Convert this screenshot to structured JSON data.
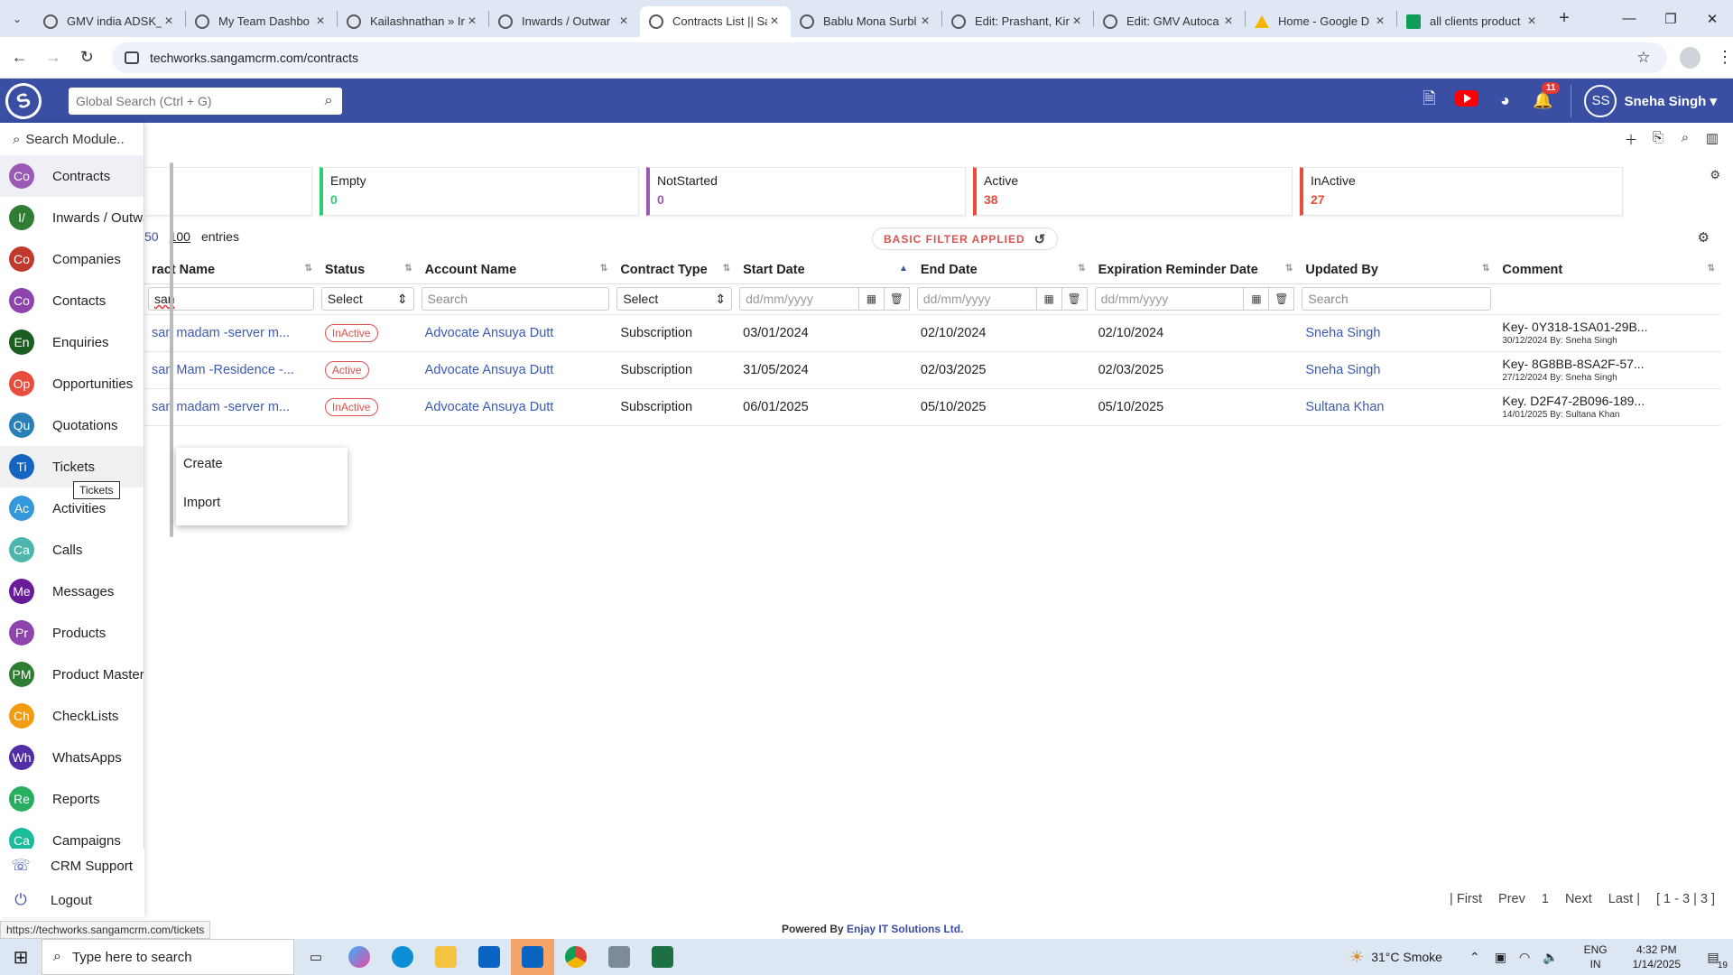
{
  "browser": {
    "tabs": [
      {
        "title": "GMV india ADSK_"
      },
      {
        "title": "My Team Dashbo"
      },
      {
        "title": "Kailashnathan » In"
      },
      {
        "title": "Inwards / Outwar"
      },
      {
        "title": "Contracts List || Sa"
      },
      {
        "title": "Bablu Mona Surbl"
      },
      {
        "title": "Edit: Prashant, Kin"
      },
      {
        "title": "Edit: GMV Autoca"
      },
      {
        "title": "Home - Google D"
      },
      {
        "title": "all clients product"
      }
    ],
    "url": "techworks.sangamcrm.com/contracts",
    "status_url": "https://techworks.sangamcrm.com/tickets"
  },
  "appbar": {
    "search_placeholder": "Global Search (Ctrl + G)",
    "notification_count": "11",
    "user_initials": "SS",
    "user_name": "Sneha Singh"
  },
  "sidebar": {
    "search_placeholder": "Search Module..",
    "items": [
      {
        "abbr": "Co",
        "label": "Contracts",
        "color": "#9b59b6"
      },
      {
        "abbr": "I/",
        "label": "Inwards / Outwa...",
        "color": "#2e7d32"
      },
      {
        "abbr": "Co",
        "label": "Companies",
        "color": "#c0392b"
      },
      {
        "abbr": "Co",
        "label": "Contacts",
        "color": "#8e44ad"
      },
      {
        "abbr": "En",
        "label": "Enquiries",
        "color": "#1b5e20"
      },
      {
        "abbr": "Op",
        "label": "Opportunities",
        "color": "#e74c3c"
      },
      {
        "abbr": "Qu",
        "label": "Quotations",
        "color": "#2980b9"
      },
      {
        "abbr": "Ti",
        "label": "Tickets",
        "color": "#1565c0"
      },
      {
        "abbr": "Ac",
        "label": "Activities",
        "color": "#3498db"
      },
      {
        "abbr": "Ca",
        "label": "Calls",
        "color": "#4db6ac"
      },
      {
        "abbr": "Me",
        "label": "Messages",
        "color": "#6a1b9a"
      },
      {
        "abbr": "Pr",
        "label": "Products",
        "color": "#8e44ad"
      },
      {
        "abbr": "PM",
        "label": "Product Masters",
        "color": "#2e7d32"
      },
      {
        "abbr": "Ch",
        "label": "CheckLists",
        "color": "#f39c12"
      },
      {
        "abbr": "Wh",
        "label": "WhatsApps",
        "color": "#512da8"
      },
      {
        "abbr": "Re",
        "label": "Reports",
        "color": "#27ae60"
      },
      {
        "abbr": "Ca",
        "label": "Campaigns",
        "color": "#1abc9c"
      }
    ],
    "crm_support": "CRM Support",
    "logout": "Logout",
    "tooltip": "Tickets"
  },
  "popup_menu": {
    "items": [
      "Create",
      "Import"
    ]
  },
  "summary_cards": [
    {
      "label": "Empty",
      "value": "0",
      "color": "#2ecc71"
    },
    {
      "label": "NotStarted",
      "value": "0",
      "color": "#9b59b6"
    },
    {
      "label": "Active",
      "value": "38",
      "color": "#e74c3c"
    },
    {
      "label": "InActive",
      "value": "27",
      "color": "#e74c3c"
    }
  ],
  "entries": {
    "opt1": "50",
    "opt2": "100",
    "label": "entries"
  },
  "filter_badge": "BASIC FILTER APPLIED",
  "table": {
    "headers": [
      "ract Name",
      "Status",
      "Account Name",
      "Contract Type",
      "Start Date",
      "End Date",
      "Expiration Reminder Date",
      "Updated By",
      "Comment"
    ],
    "filters": {
      "name_value": "san",
      "status": "Select",
      "account_placeholder": "Search",
      "type": "Select",
      "date_placeholder": "dd/mm/yyyy",
      "updated_placeholder": "Search"
    },
    "rows": [
      {
        "name": "san madam -server m...",
        "status": "InActive",
        "account": "Advocate Ansuya Dutt",
        "type": "Subscription",
        "start": "03/01/2024",
        "end": "02/10/2024",
        "reminder": "02/10/2024",
        "updated_by": "Sneha Singh",
        "comment": "Key- 0Y318-1SA01-29B...",
        "comment_meta": "30/12/2024 By: Sneha Singh"
      },
      {
        "name": "san Mam -Residence -...",
        "status": "Active",
        "account": "Advocate Ansuya Dutt",
        "type": "Subscription",
        "start": "31/05/2024",
        "end": "02/03/2025",
        "reminder": "02/03/2025",
        "updated_by": "Sneha Singh",
        "comment": "Key- 8G8BB-8SA2F-57...",
        "comment_meta": "27/12/2024 By: Sneha Singh"
      },
      {
        "name": "san madam -server m...",
        "status": "InActive",
        "account": "Advocate Ansuya Dutt",
        "type": "Subscription",
        "start": "06/01/2025",
        "end": "05/10/2025",
        "reminder": "05/10/2025",
        "updated_by": "Sultana Khan",
        "comment": "Key. D2F47-2B096-189...",
        "comment_meta": "14/01/2025 By: Sultana Khan"
      }
    ]
  },
  "pager": {
    "first": "| First",
    "prev": "Prev",
    "page": "1",
    "next": "Next",
    "last": "Last |",
    "range": "[ 1 - 3 | 3 ]"
  },
  "footer": {
    "powered_prefix": "Powered By",
    "company": "Enjay IT Solutions Ltd."
  },
  "taskbar": {
    "search_placeholder": "Type here to search",
    "weather": "31°C  Smoke",
    "lang1": "ENG",
    "lang2": "IN",
    "time": "4:32 PM",
    "date": "1/14/2025",
    "notif": "19"
  }
}
